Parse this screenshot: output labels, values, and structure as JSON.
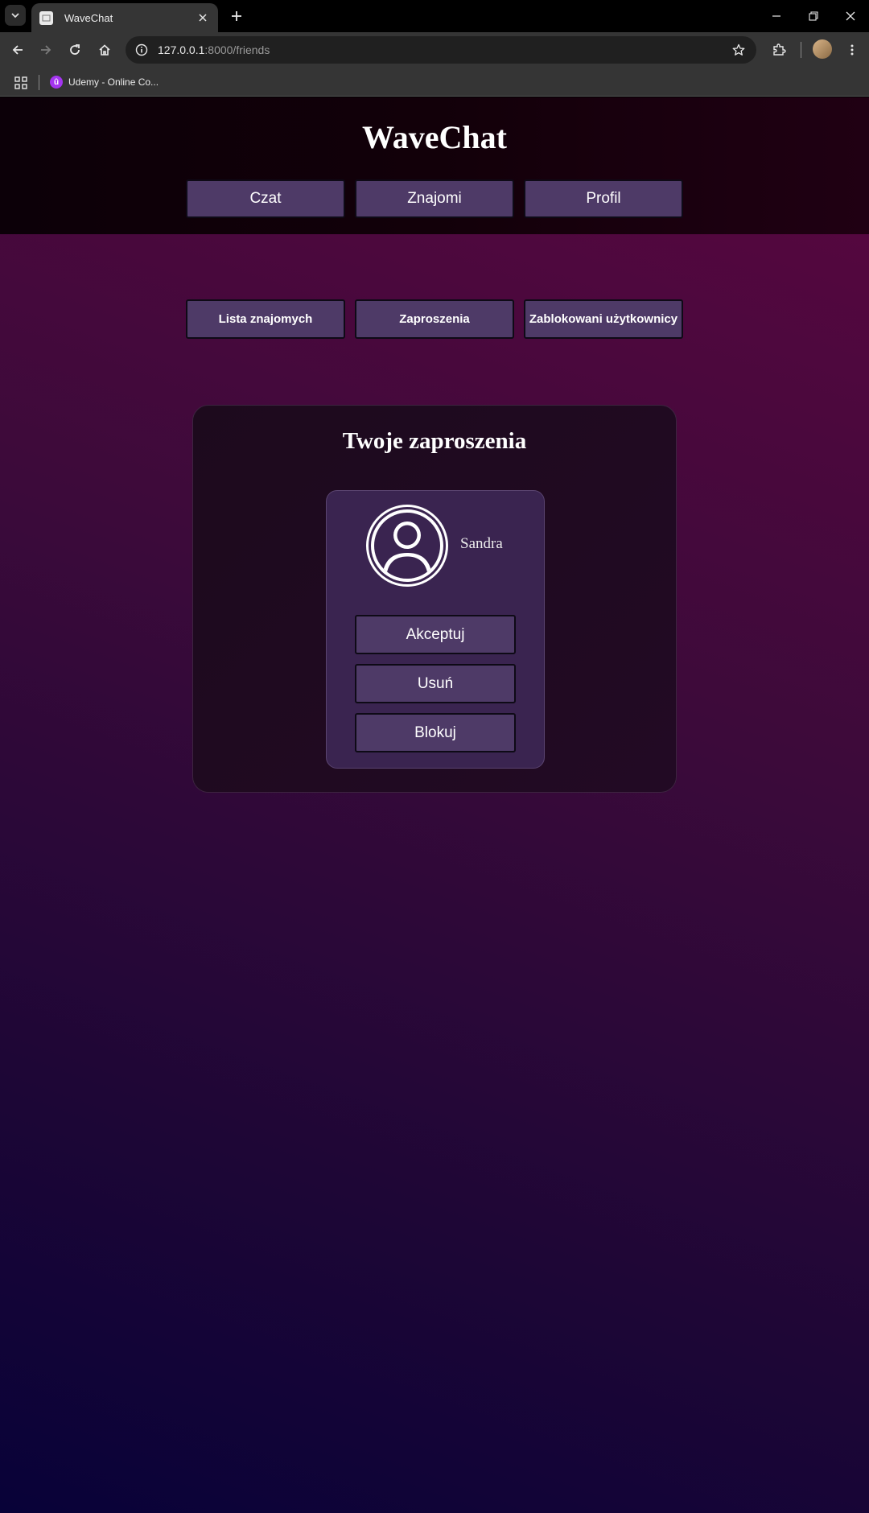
{
  "browser": {
    "tab_title": "WaveChat",
    "url_host": "127.0.0.1",
    "url_path": ":8000/friends",
    "bookmark_label": "Udemy - Online Co...",
    "bookmark_icon_letter": "û"
  },
  "site": {
    "title": "WaveChat",
    "nav": [
      "Czat",
      "Znajomi",
      "Profil"
    ]
  },
  "friends": {
    "tabs": [
      "Lista znajomych",
      "Zaproszenia",
      "Zablokowani użytkownicy"
    ],
    "invites_title": "Twoje zaproszenia",
    "invite": {
      "name": "Sandra",
      "actions": [
        "Akceptuj",
        "Usuń",
        "Blokuj"
      ]
    }
  },
  "colors": {
    "button_bg": "#4e3a67",
    "card_bg": "#3a2450",
    "panel_bg": "#1d0a1d"
  }
}
